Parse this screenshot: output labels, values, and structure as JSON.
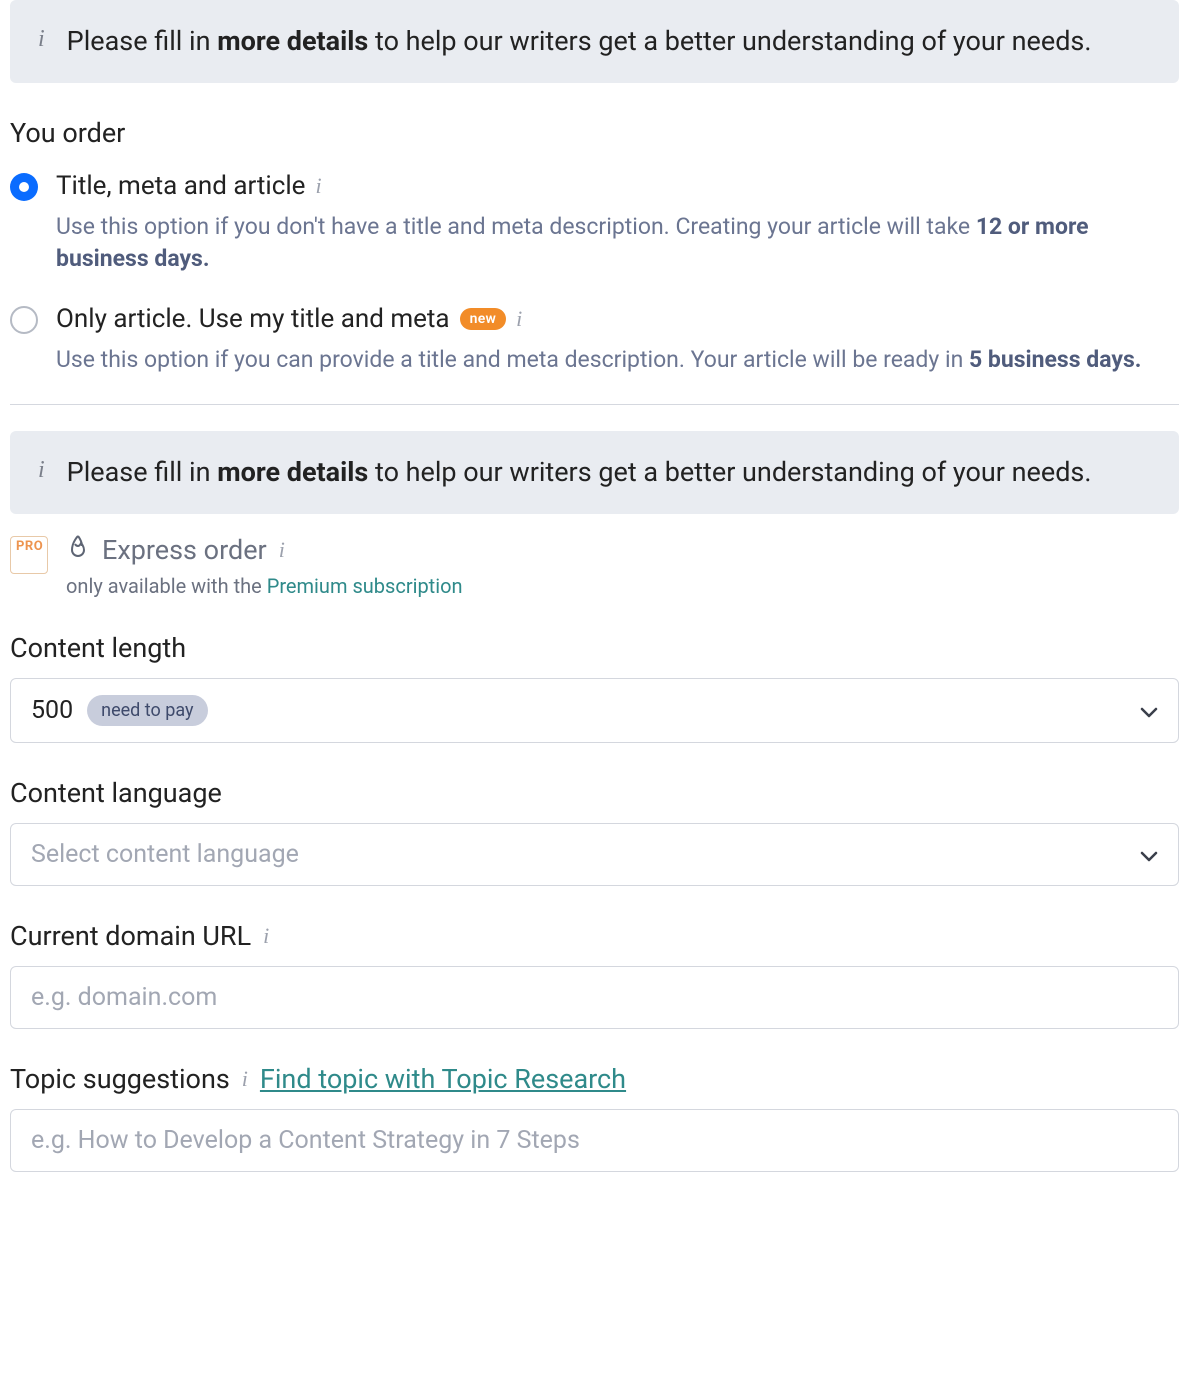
{
  "banner1": {
    "text_before": "Please fill in ",
    "text_bold": "more details",
    "text_after": " to help our writers get a better understanding of your needs."
  },
  "you_order": {
    "heading": "You order",
    "option1": {
      "label": "Title, meta and article",
      "desc_before": "Use this option if you don't have a title and meta description. Creating your article will take ",
      "desc_bold": "12 or more business days."
    },
    "option2": {
      "label": "Only article. Use my title and meta",
      "badge": "new",
      "desc_before": "Use this option if you can provide a title and meta description. Your article will be ready in ",
      "desc_bold": "5 business days."
    }
  },
  "banner2": {
    "text_before": "Please fill in ",
    "text_bold": "more details",
    "text_after": " to help our writers get a better understanding of your needs."
  },
  "express": {
    "pro_badge": "PRO",
    "title": "Express order",
    "sub_before": "only available with the ",
    "sub_link": "Premium subscription"
  },
  "content_length": {
    "label": "Content length",
    "value": "500",
    "pill": "need to pay"
  },
  "content_language": {
    "label": "Content language",
    "placeholder": "Select content language"
  },
  "domain_url": {
    "label": "Current domain URL",
    "placeholder": "e.g. domain.com"
  },
  "topic": {
    "label": "Topic suggestions",
    "link": "Find topic with Topic Research",
    "placeholder": "e.g. How to Develop a Content Strategy in 7 Steps"
  }
}
